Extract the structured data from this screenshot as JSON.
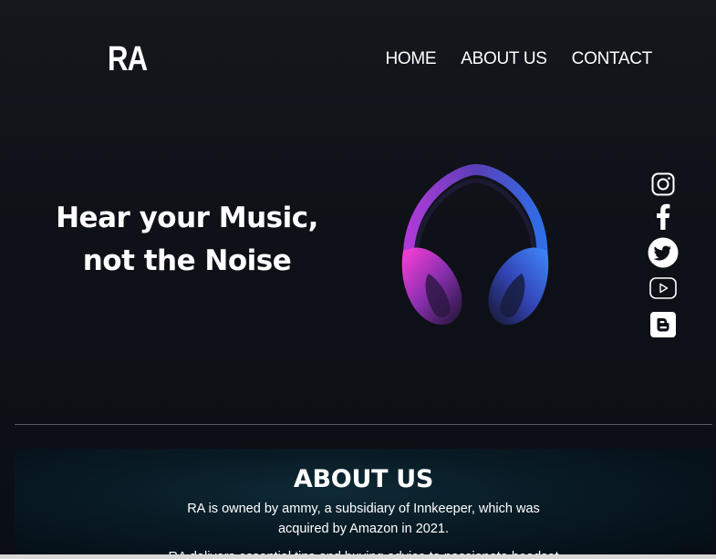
{
  "brand": {
    "logo": "RA"
  },
  "nav": {
    "items": [
      {
        "label": "HOME"
      },
      {
        "label": "ABOUT US"
      },
      {
        "label": "CONTACT"
      }
    ]
  },
  "hero": {
    "title_line1": "Hear your Music,",
    "title_line2": "not the Noise",
    "image_icon": "headphones-image"
  },
  "social": {
    "icons": [
      "instagram-icon",
      "facebook-icon",
      "twitter-icon",
      "youtube-icon",
      "blogger-icon"
    ]
  },
  "about": {
    "heading": "ABOUT US",
    "paragraph1_line1": "RA is owned by ammy, a subsidiary of Innkeeper, which was",
    "paragraph1_line2": "acquired by Amazon in 2021.",
    "paragraph2": "RA delivers essential tips and buying advice to passionate headset"
  },
  "colors": {
    "background": "#0e1017",
    "text": "#ffffff",
    "about_bg": "#081a24",
    "headphone_pink": "#e23bd6",
    "headphone_blue": "#3b6bff"
  }
}
